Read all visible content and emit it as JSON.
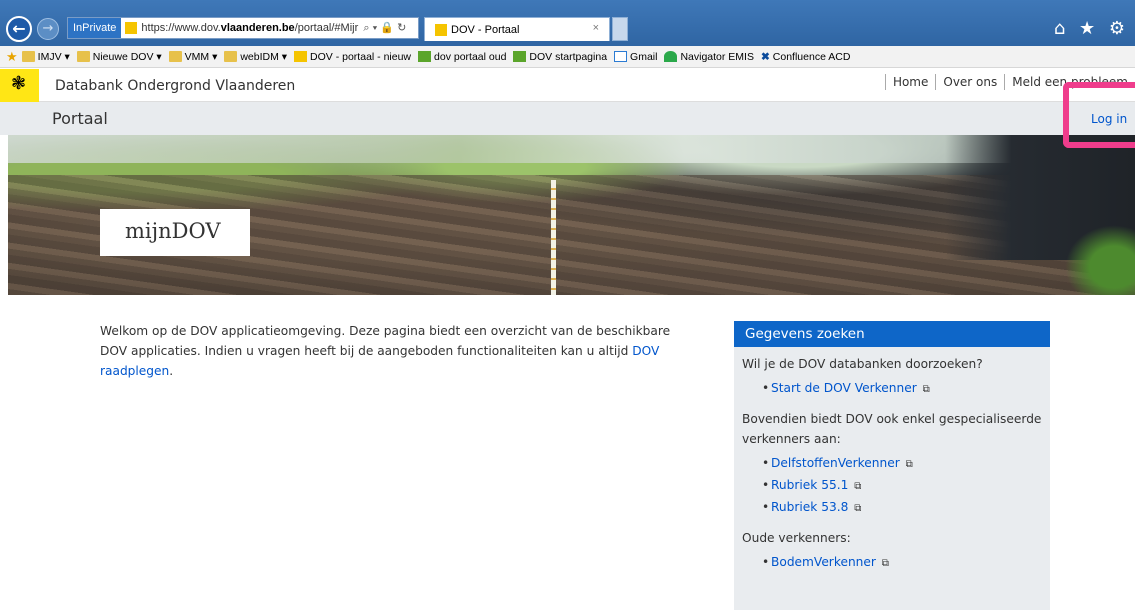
{
  "browser": {
    "inprivate_label": "InPrivate",
    "url_prefix": "https://www.dov.",
    "url_domain": "vlaanderen.be",
    "url_rest": "/portaal/#Mijr",
    "url_controls": "⌕ ▾ 🔒 ↻",
    "tab_title": "DOV - Portaal",
    "tab_close": "×",
    "right_icons": "⌂ ★ ⚙"
  },
  "favorites": [
    {
      "label": "IMJV ▾",
      "icon": "folder-icon"
    },
    {
      "label": "Nieuwe DOV ▾",
      "icon": "folder-icon"
    },
    {
      "label": "VMM ▾",
      "icon": "folder-icon"
    },
    {
      "label": "webIDM ▾",
      "icon": "folder-icon"
    },
    {
      "label": "DOV - portaal - nieuw",
      "icon": "dov-icon"
    },
    {
      "label": "dov portaal oud",
      "icon": "check-icon"
    },
    {
      "label": "DOV startpagina",
      "icon": "check-icon"
    },
    {
      "label": "Gmail",
      "icon": "gmail-icon"
    },
    {
      "label": "Navigator EMIS",
      "icon": "emis-icon"
    },
    {
      "label": "Confluence ACD",
      "icon": "confluence-icon"
    }
  ],
  "site": {
    "name": "Databank Ondergrond Vlaanderen",
    "nav": [
      "Home",
      "Over ons",
      "Meld een probleem"
    ],
    "portal_title": "Portaal",
    "login": "Log in"
  },
  "hero": {
    "label": "mijnDOV"
  },
  "intro": {
    "text": "Welkom op de DOV applicatieomgeving. Deze pagina biedt een overzicht van de beschikbare DOV applicaties. Indien u vragen heeft bij de aangeboden functionaliteiten kan u altijd ",
    "link": "DOV raadplegen",
    "end": "."
  },
  "panel": {
    "title": "Gegevens zoeken",
    "q1": "Wil je de DOV databanken doorzoeken?",
    "list1": [
      "Start de DOV Verkenner"
    ],
    "q2": "Bovendien biedt DOV ook enkel gespecialiseerde verkenners aan:",
    "list2": [
      "DelfstoffenVerkenner",
      "Rubriek 55.1",
      "Rubriek 53.8"
    ],
    "q3": "Oude verkenners:",
    "list3": [
      "BodemVerkenner"
    ],
    "ext_icon": "external-link-icon"
  }
}
